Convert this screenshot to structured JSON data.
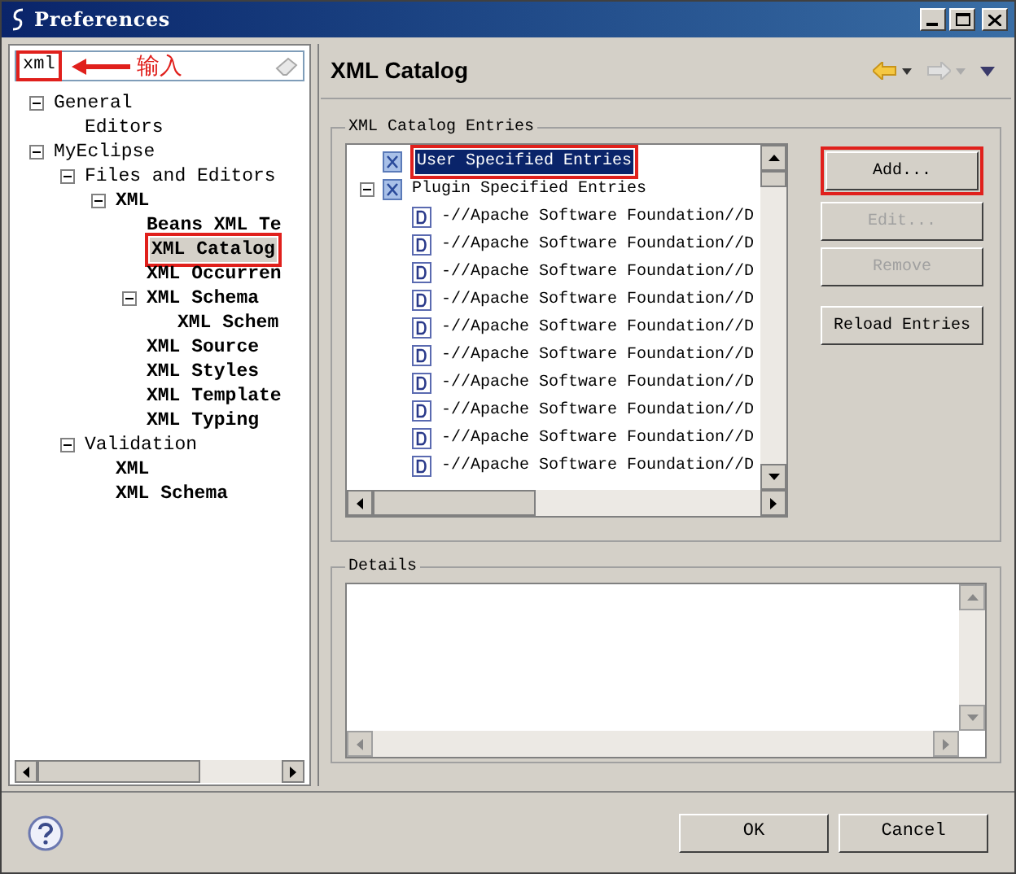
{
  "window": {
    "title": "Preferences"
  },
  "filter": {
    "value": "xml",
    "annotated": true
  },
  "annotation": {
    "label": "输入"
  },
  "tree": [
    {
      "label": "General",
      "matched": false,
      "selected": false,
      "annotated": false,
      "expanded": true,
      "children": [
        {
          "label": "Editors",
          "matched": false,
          "selected": false,
          "annotated": false
        }
      ]
    },
    {
      "label": "MyEclipse",
      "matched": false,
      "selected": false,
      "annotated": false,
      "expanded": true,
      "children": [
        {
          "label": "Files and Editors",
          "matched": false,
          "selected": false,
          "annotated": false,
          "expanded": true,
          "children": [
            {
              "label": "XML",
              "matched": true,
              "selected": false,
              "annotated": false,
              "expanded": true,
              "children": [
                {
                  "label": "Beans XML Te",
                  "matched": true,
                  "selected": false,
                  "annotated": false
                },
                {
                  "label": "XML Catalog",
                  "matched": true,
                  "selected": true,
                  "annotated": true
                },
                {
                  "label": "XML Occurren",
                  "matched": true,
                  "selected": false,
                  "annotated": false
                },
                {
                  "label": "XML Schema",
                  "matched": true,
                  "selected": false,
                  "annotated": false,
                  "expanded": true,
                  "children": [
                    {
                      "label": "XML Schem",
                      "matched": true,
                      "selected": false,
                      "annotated": false
                    }
                  ]
                },
                {
                  "label": "XML Source",
                  "matched": true,
                  "selected": false,
                  "annotated": false
                },
                {
                  "label": "XML Styles",
                  "matched": true,
                  "selected": false,
                  "annotated": false
                },
                {
                  "label": "XML Template",
                  "matched": true,
                  "selected": false,
                  "annotated": false
                },
                {
                  "label": "XML Typing",
                  "matched": true,
                  "selected": false,
                  "annotated": false
                }
              ]
            }
          ]
        },
        {
          "label": "Validation",
          "matched": false,
          "selected": false,
          "annotated": false,
          "expanded": true,
          "children": [
            {
              "label": "XML",
              "matched": true,
              "selected": false,
              "annotated": false
            },
            {
              "label": "XML Schema",
              "matched": true,
              "selected": false,
              "annotated": false
            }
          ]
        }
      ]
    }
  ],
  "page": {
    "title": "XML Catalog"
  },
  "catalog": {
    "title": "XML Catalog Entries",
    "entries": [
      {
        "label": "User Specified Entries",
        "kind": "catalog",
        "selected": true,
        "annotated": true
      },
      {
        "label": "Plugin Specified Entries",
        "kind": "catalog",
        "selected": false,
        "annotated": false,
        "expanded": true,
        "children": [
          {
            "label": "-//Apache Software Foundation//D",
            "kind": "dtd",
            "selected": false,
            "annotated": false
          },
          {
            "label": "-//Apache Software Foundation//D",
            "kind": "dtd",
            "selected": false,
            "annotated": false
          },
          {
            "label": "-//Apache Software Foundation//D",
            "kind": "dtd",
            "selected": false,
            "annotated": false
          },
          {
            "label": "-//Apache Software Foundation//D",
            "kind": "dtd",
            "selected": false,
            "annotated": false
          },
          {
            "label": "-//Apache Software Foundation//D",
            "kind": "dtd",
            "selected": false,
            "annotated": false
          },
          {
            "label": "-//Apache Software Foundation//D",
            "kind": "dtd",
            "selected": false,
            "annotated": false
          },
          {
            "label": "-//Apache Software Foundation//D",
            "kind": "dtd",
            "selected": false,
            "annotated": false
          },
          {
            "label": "-//Apache Software Foundation//D",
            "kind": "dtd",
            "selected": false,
            "annotated": false
          },
          {
            "label": "-//Apache Software Foundation//D",
            "kind": "dtd",
            "selected": false,
            "annotated": false
          },
          {
            "label": "-//Apache Software Foundation//D",
            "kind": "dtd",
            "selected": false,
            "annotated": false
          }
        ]
      }
    ],
    "buttons": [
      {
        "label": "Add...",
        "disabled": false,
        "annotated": true
      },
      {
        "label": "Edit...",
        "disabled": true,
        "annotated": false
      },
      {
        "label": "Remove",
        "disabled": true,
        "annotated": false
      },
      {
        "label": "Reload Entries",
        "disabled": false,
        "annotated": false
      }
    ]
  },
  "details": {
    "title": "Details"
  },
  "footer": {
    "buttons": [
      "OK",
      "Cancel"
    ]
  }
}
